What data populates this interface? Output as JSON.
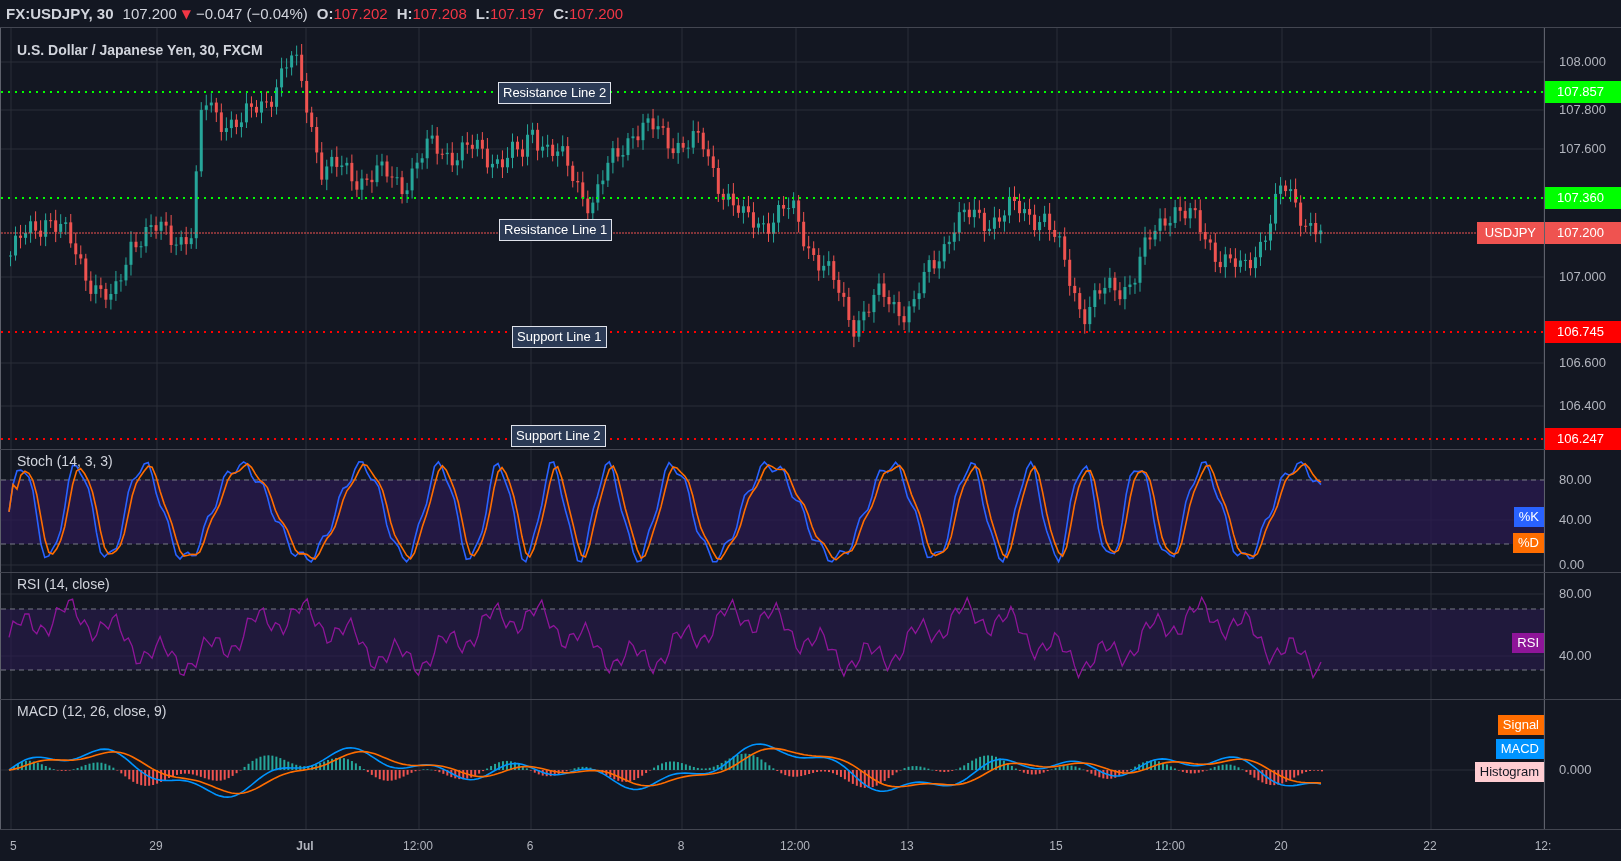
{
  "header": {
    "symbol": "FX:USDJPY, 30",
    "last": "107.200",
    "arrow": "▼",
    "falling": true,
    "change": "−0.047 (−0.04%)",
    "ohlc": [
      {
        "label": "O:",
        "value": "107.202"
      },
      {
        "label": "H:",
        "value": "107.208"
      },
      {
        "label": "L:",
        "value": "107.197"
      },
      {
        "label": "C:",
        "value": "107.200"
      }
    ]
  },
  "main_pane": {
    "title": "U.S. Dollar / Japanese Yen, 30, FXCM",
    "levels": [
      {
        "label": "Resistance Line 2",
        "price": "107.857",
        "color": "#00ff00"
      },
      {
        "label": "Resistance Line 1",
        "price": "107.360",
        "color": "#00ff00"
      },
      {
        "label": "Support Line 1",
        "price": "106.745",
        "color": "#ff0000"
      },
      {
        "label": "Support Line 2",
        "price": "106.247",
        "color": "#ff0000"
      }
    ],
    "current_price": {
      "symbol": "USDJPY",
      "price": "107.200"
    },
    "axis_ticks": [
      "108.000",
      "107.800",
      "107.600",
      "107.000",
      "106.600",
      "106.400"
    ]
  },
  "stoch_pane": {
    "title": "Stoch (14, 3, 3)",
    "legend": [
      {
        "label": "%K",
        "color": "#2962ff"
      },
      {
        "label": "%D",
        "color": "#ff6d00"
      }
    ],
    "axis_ticks": [
      "80.00",
      "40.00",
      "0.00"
    ]
  },
  "rsi_pane": {
    "title": "RSI (14, close)",
    "legend": [
      {
        "label": "RSI",
        "color": "#8e1599"
      }
    ],
    "axis_ticks": [
      "80.00",
      "40.00"
    ]
  },
  "macd_pane": {
    "title": "MACD (12, 26, close, 9)",
    "legend": [
      {
        "label": "Signal",
        "color": "#ff6d00"
      },
      {
        "label": "MACD",
        "color": "#0094ff"
      },
      {
        "label": "Histogram",
        "color": "#ffcdd2"
      }
    ],
    "axis_ticks": [
      "0.000"
    ]
  },
  "time_axis": [
    {
      "label": "5",
      "bold": false
    },
    {
      "label": "29",
      "bold": false
    },
    {
      "label": "Jul",
      "bold": true
    },
    {
      "label": "12:00",
      "bold": false
    },
    {
      "label": "6",
      "bold": false
    },
    {
      "label": "8",
      "bold": false
    },
    {
      "label": "12:00",
      "bold": false
    },
    {
      "label": "13",
      "bold": false
    },
    {
      "label": "15",
      "bold": false
    },
    {
      "label": "12:00",
      "bold": false
    },
    {
      "label": "20",
      "bold": false
    },
    {
      "label": "22",
      "bold": false
    },
    {
      "label": "12:",
      "bold": false
    }
  ]
}
